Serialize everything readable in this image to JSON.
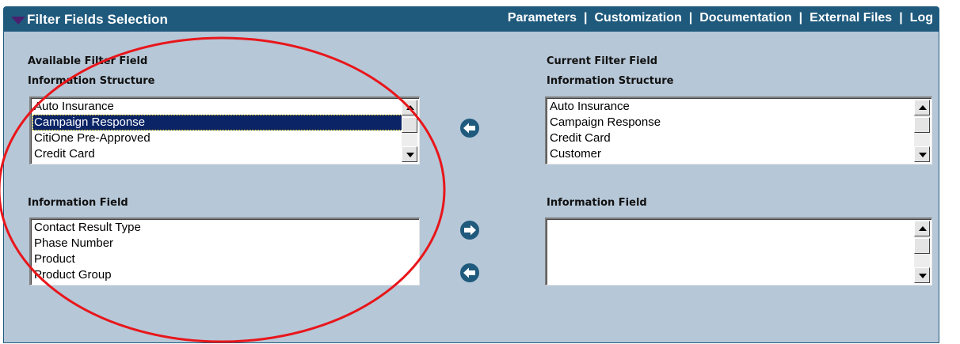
{
  "header": {
    "title": "Filter Fields Selection",
    "links": [
      "Parameters",
      "Customization",
      "Documentation",
      "External Files",
      "Log"
    ],
    "separator": "|"
  },
  "available": {
    "heading": "Available Filter Field",
    "structure_label": "Information Structure",
    "structures": [
      "Auto Insurance",
      "Campaign Response",
      "CitiOne Pre-Approved",
      "Credit Card"
    ],
    "selected_structure": "Campaign Response",
    "field_label": "Information Field",
    "fields": [
      "Contact Result Type",
      "Phase Number",
      "Product",
      "Product Group"
    ]
  },
  "current": {
    "heading": "Current Filter Field",
    "structure_label": "Information Structure",
    "structures": [
      "Auto Insurance",
      "Campaign Response",
      "Credit Card",
      "Customer"
    ],
    "field_label": "Information Field",
    "fields": []
  },
  "colors": {
    "header_bg": "#1f5a7d",
    "panel_bg": "#b6c7d7",
    "selection_bg": "#0a2466",
    "arrow_button": "#1f5a7d",
    "annotation": "#e8161b"
  },
  "icons": {
    "title_indicator": "triangle-down-icon",
    "move_left": "arrow-left-icon",
    "move_right": "arrow-right-icon"
  }
}
